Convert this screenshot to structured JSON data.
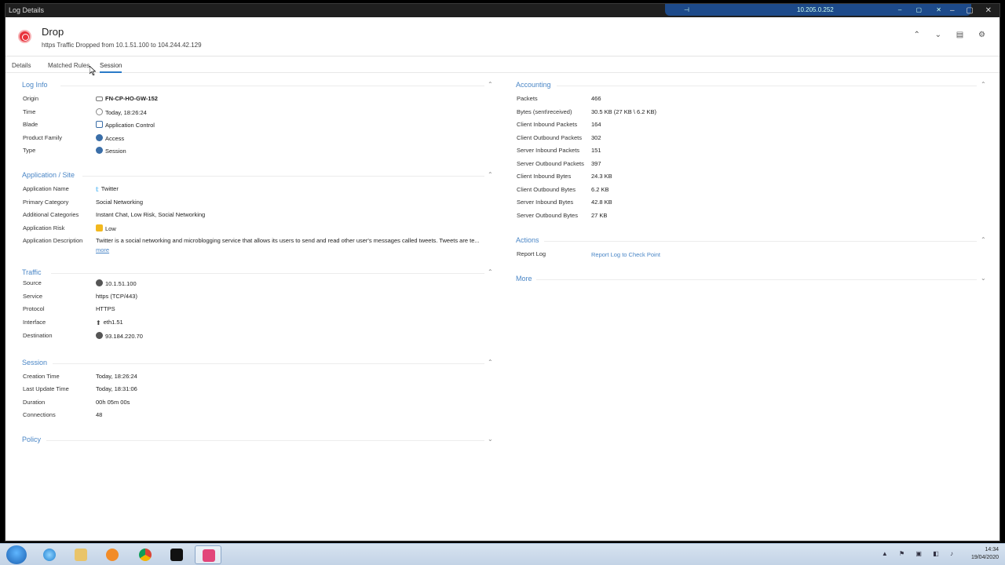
{
  "window": {
    "title": "Log Details",
    "controls": "– ▢ ✕"
  },
  "remote": {
    "pin": "⊣",
    "ip": "10.205.0.252",
    "controls": "– ▢ ✕"
  },
  "header": {
    "title": "Drop",
    "subtitle": "https Traffic Dropped from 10.1.51.100 to 104.244.42.129",
    "nav": "⌃ ⌄ ▤ ⚙"
  },
  "tabs": [
    {
      "label": "Details"
    },
    {
      "label": "Matched Rules"
    },
    {
      "label": "Session"
    }
  ],
  "log_info": {
    "title": "Log Info",
    "rows": [
      {
        "label": "Origin",
        "value": "FN-CP-HO-GW-152"
      },
      {
        "label": "Time",
        "value": "Today, 18:26:24"
      },
      {
        "label": "Blade",
        "value": "Application Control"
      },
      {
        "label": "Product Family",
        "value": "Access"
      },
      {
        "label": "Type",
        "value": "Session"
      }
    ]
  },
  "application": {
    "title": "Application / Site",
    "rows": [
      {
        "label": "Application Name",
        "value": "Twitter"
      },
      {
        "label": "Primary Category",
        "value": "Social Networking"
      },
      {
        "label": "Additional Categories",
        "value": "Instant Chat, Low Risk, Social Networking"
      },
      {
        "label": "Application Risk",
        "value": "Low"
      },
      {
        "label": "Application Description",
        "value": "Twitter is a social networking and microblogging service that allows its users to send and read other user's messages called tweets. Tweets are te..."
      }
    ],
    "more": "more"
  },
  "traffic": {
    "title": "Traffic",
    "rows": [
      {
        "label": "Source",
        "value": "10.1.51.100"
      },
      {
        "label": "Service",
        "value": "https (TCP/443)"
      },
      {
        "label": "Protocol",
        "value": "HTTPS"
      },
      {
        "label": "Interface",
        "value": "eth1.51"
      },
      {
        "label": "Destination",
        "value": "93.184.220.70"
      }
    ]
  },
  "session": {
    "title": "Session",
    "rows": [
      {
        "label": "Creation Time",
        "value": "Today, 18:26:24"
      },
      {
        "label": "Last Update Time",
        "value": "Today, 18:31:06"
      },
      {
        "label": "Duration",
        "value": "00h 05m 00s"
      },
      {
        "label": "Connections",
        "value": "48"
      }
    ]
  },
  "policy": {
    "title": "Policy"
  },
  "accounting": {
    "title": "Accounting",
    "rows": [
      {
        "label": "Packets",
        "value": "466"
      },
      {
        "label": "Bytes (sent\\received)",
        "value": "30.5 KB (27 KB \\ 6.2 KB)"
      },
      {
        "label": "Client Inbound Packets",
        "value": "164"
      },
      {
        "label": "Client Outbound Packets",
        "value": "302"
      },
      {
        "label": "Server Inbound Packets",
        "value": "151"
      },
      {
        "label": "Server Outbound Packets",
        "value": "397"
      },
      {
        "label": "Client Inbound Bytes",
        "value": "24.3 KB"
      },
      {
        "label": "Client Outbound Bytes",
        "value": "6.2 KB"
      },
      {
        "label": "Server Inbound Bytes",
        "value": "42.8 KB"
      },
      {
        "label": "Server Outbound Bytes",
        "value": "27 KB"
      }
    ]
  },
  "actions": {
    "title": "Actions",
    "report_label": "Report Log",
    "report_link": "Report Log to Check Point"
  },
  "more_section": {
    "title": "More"
  },
  "taskbar": {
    "time": "14:34",
    "date": "19/04/2020",
    "tray": "▲ ⚑ ▣ ◧ ♪"
  },
  "colors": {
    "accent": "#4a86c6",
    "drop_red": "#e8323b",
    "title_bar": "#1f1f1f"
  }
}
